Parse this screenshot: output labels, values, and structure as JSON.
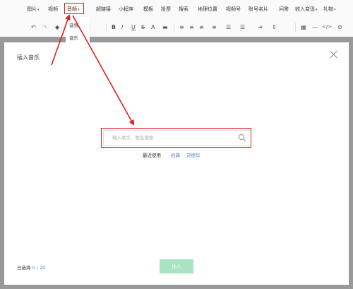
{
  "menubar": {
    "items": [
      {
        "label": "图片",
        "caret": true
      },
      {
        "label": "视频",
        "caret": false
      },
      {
        "label": "音频",
        "caret": true
      },
      {
        "label": "超链接",
        "caret": false
      },
      {
        "label": "小程序",
        "caret": false
      },
      {
        "label": "模板",
        "caret": false
      },
      {
        "label": "投票",
        "caret": false
      },
      {
        "label": "搜索",
        "caret": false
      },
      {
        "label": "地理位置",
        "caret": false
      },
      {
        "label": "视频号",
        "caret": false
      },
      {
        "label": "账号名片",
        "caret": false
      },
      {
        "label": "问答",
        "caret": false
      },
      {
        "label": "收入变现",
        "caret": true
      },
      {
        "label": "礼物",
        "caret": true
      }
    ],
    "caret_glyph": "▾"
  },
  "dropdown": {
    "items": [
      "音频",
      "音乐"
    ]
  },
  "toolbar": {
    "undo": "↶",
    "redo": "↷",
    "eraser": "◆",
    "bold": "B",
    "italic": "I",
    "underline": "U",
    "strike": "S",
    "font_color": "A",
    "bg_color": "▬",
    "align1": "≡",
    "align2": "≡",
    "align3": "≡",
    "align4": "≡",
    "list1": "☰",
    "list2": "☰",
    "indent": "⇥",
    "spacing": "⇕",
    "table": "▦",
    "more": "—",
    "code": "</>",
    "link": "⊘"
  },
  "modal": {
    "title": "插入音乐",
    "search_placeholder": "输入歌手、歌名搜索",
    "search_value": "",
    "quick_label": "最近使用",
    "quick_links": [
      "经典",
      "刘德华"
    ],
    "selected_label": "已选择",
    "selected_count": "0 / 20",
    "insert_label": "插入"
  },
  "colors": {
    "annotation": "#e02020",
    "link": "#5b7fb5",
    "insert_button": "#a9e3c4"
  }
}
